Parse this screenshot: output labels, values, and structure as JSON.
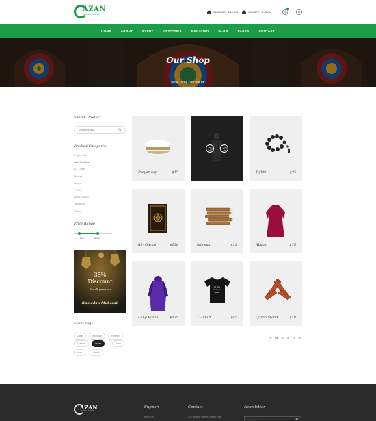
{
  "header": {
    "logo_text": "AZAN",
    "logo_sub": "ISLAMIC CENTER",
    "sunrise": "SUNRISE : 5.10 AM",
    "sunset": "SUNSET : 5.43 PM"
  },
  "nav": [
    "HOME",
    "ABOUT",
    "EVENT",
    "ACTIVITIES",
    "DONATION",
    "BLOG",
    "PAGES",
    "CONTACT"
  ],
  "banner": {
    "title": "Our Shop",
    "breadcrumb": "Home - Shop - Left side bar"
  },
  "sidebar": {
    "search_title": "Search Product",
    "search_placeholder": "Keywords here...",
    "categories_title": "Product Categories",
    "categories": [
      "Prayer Cap",
      "Attar Perfume",
      "Al - Quran",
      "Miswak",
      "Abaya",
      "T-Shirt",
      "Quran Stand",
      "Jainamaz",
      "Others..."
    ],
    "active_category_index": 1,
    "price_title": "Price Range",
    "price_min": "$16",
    "price_max": "$290",
    "promo": {
      "percent": "35%",
      "discount": "Discount",
      "for_all": "For all products",
      "ramadan": "Ramadan Mubarak"
    },
    "tags_title": "Event Tags",
    "tags": [
      "Zakat",
      "Ramadan",
      "Faremik",
      "Quraish",
      "Quran",
      "Islam",
      "Iman",
      "Hadith"
    ],
    "active_tag_index": 4
  },
  "products": [
    {
      "name": "Prayer cup",
      "price": "$15",
      "image": "prayer-cap"
    },
    {
      "name": "",
      "price": "",
      "image": "perfume-bottle",
      "hover": true
    },
    {
      "name": "Tajbhi",
      "price": "$35",
      "image": "prayer-beads"
    },
    {
      "name": "Al - Quran",
      "price": "$110",
      "image": "quran-book"
    },
    {
      "name": "Miswak",
      "price": "$12",
      "image": "miswak-sticks"
    },
    {
      "name": "Abaya",
      "price": "$75",
      "image": "abaya-dress"
    },
    {
      "name": "Long Borka",
      "price": "$135",
      "image": "borka-dress"
    },
    {
      "name": "T - Shirt",
      "price": "$45",
      "image": "t-shirt"
    },
    {
      "name": "Quran Stand",
      "price": "$18",
      "image": "quran-stand"
    }
  ],
  "tshirt_print": [
    "In the",
    "Name of",
    "Allah"
  ],
  "pagination": [
    "01",
    "02",
    "03",
    "04",
    "05",
    "06"
  ],
  "active_page_index": 1,
  "footer": {
    "logo_text": "AZAN",
    "logo_sub": "ISLAMIC CENTER",
    "col1_title": "Support",
    "col1_item": "About us",
    "col2_title": "Contact",
    "col2_item": "231 Islamic Center, Center Hall",
    "col3_title": "Newsletter",
    "newsletter_placeholder": "Email here..."
  },
  "colors": {
    "brand": "#1f9c47",
    "footer": "#2b2b2b",
    "card": "#efefef"
  }
}
